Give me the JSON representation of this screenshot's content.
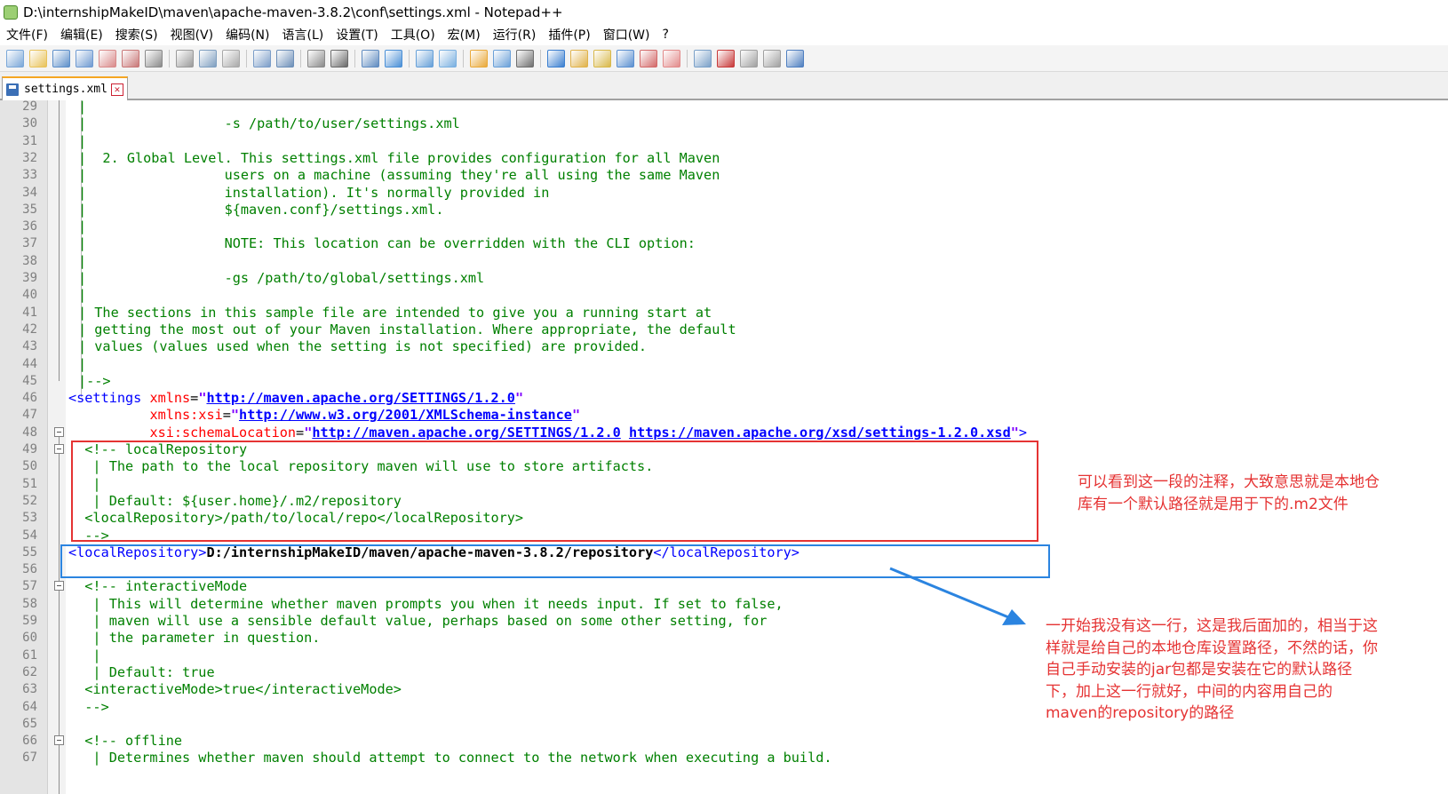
{
  "window": {
    "title": "D:\\internshipMakeID\\maven\\apache-maven-3.8.2\\conf\\settings.xml - Notepad++"
  },
  "menu": [
    "文件(F)",
    "编辑(E)",
    "搜索(S)",
    "视图(V)",
    "编码(N)",
    "语言(L)",
    "设置(T)",
    "工具(O)",
    "宏(M)",
    "运行(R)",
    "插件(P)",
    "窗口(W)",
    "?"
  ],
  "toolbar_icons": [
    "new-file-icon",
    "open-file-icon",
    "save-icon",
    "save-all-icon",
    "close-icon",
    "close-all-icon",
    "print-icon",
    "|",
    "cut-icon",
    "copy-icon",
    "paste-icon",
    "|",
    "undo-icon",
    "redo-icon",
    "|",
    "find-icon",
    "replace-icon",
    "|",
    "zoom-in-icon",
    "zoom-out-icon",
    "|",
    "sync-vertical-icon",
    "sync-horizontal-icon",
    "|",
    "word-wrap-icon",
    "show-all-chars-icon",
    "indent-guide-icon",
    "|",
    "user-lang-icon",
    "doc-map-icon",
    "function-list-icon",
    "folder-workspace-icon",
    "doc-list-icon",
    "monitoring-icon",
    "|",
    "record-macro-icon",
    "stop-macro-icon",
    "play-macro-icon",
    "run-macro-multiple-icon",
    "save-macro-icon"
  ],
  "tab": {
    "label": "settings.xml"
  },
  "lines": [
    {
      "n": "29",
      "segs": [
        [
          "c-com",
          "|"
        ]
      ]
    },
    {
      "n": "30",
      "segs": [
        [
          "c-com",
          "|                 -s /path/to/user/settings.xml"
        ]
      ]
    },
    {
      "n": "31",
      "segs": [
        [
          "c-com",
          "|"
        ]
      ]
    },
    {
      "n": "32",
      "segs": [
        [
          "c-com",
          "|  2. Global Level. This settings.xml file provides configuration for all Maven"
        ]
      ]
    },
    {
      "n": "33",
      "segs": [
        [
          "c-com",
          "|                 users on a machine (assuming they're all using the same Maven"
        ]
      ]
    },
    {
      "n": "34",
      "segs": [
        [
          "c-com",
          "|                 installation). It's normally provided in"
        ]
      ]
    },
    {
      "n": "35",
      "segs": [
        [
          "c-com",
          "|                 ${maven.conf}/settings.xml."
        ]
      ]
    },
    {
      "n": "36",
      "segs": [
        [
          "c-com",
          "|"
        ]
      ]
    },
    {
      "n": "37",
      "segs": [
        [
          "c-com",
          "|                 NOTE: This location can be overridden with the CLI option:"
        ]
      ]
    },
    {
      "n": "38",
      "segs": [
        [
          "c-com",
          "|"
        ]
      ]
    },
    {
      "n": "39",
      "segs": [
        [
          "c-com",
          "|                 -gs /path/to/global/settings.xml"
        ]
      ]
    },
    {
      "n": "40",
      "segs": [
        [
          "c-com",
          "|"
        ]
      ]
    },
    {
      "n": "41",
      "segs": [
        [
          "c-com",
          "| The sections in this sample file are intended to give you a running start at"
        ]
      ]
    },
    {
      "n": "42",
      "segs": [
        [
          "c-com",
          "| getting the most out of your Maven installation. Where appropriate, the default"
        ]
      ]
    },
    {
      "n": "43",
      "segs": [
        [
          "c-com",
          "| values (values used when the setting is not specified) are provided."
        ]
      ]
    },
    {
      "n": "44",
      "segs": [
        [
          "c-com",
          "|"
        ]
      ]
    },
    {
      "n": "45",
      "segs": [
        [
          "c-com",
          "|-->"
        ]
      ]
    },
    {
      "n": "46",
      "segs": [
        [
          "c-tag",
          "<settings "
        ],
        [
          "c-attr",
          "xmlns"
        ],
        [
          "c-plain",
          "="
        ],
        [
          "c-str",
          "\""
        ],
        [
          "c-url",
          "http://maven.apache.org/SETTINGS/1.2.0"
        ],
        [
          "c-str",
          "\""
        ]
      ]
    },
    {
      "n": "47",
      "segs": [
        [
          "c-plain",
          "          "
        ],
        [
          "c-attr",
          "xmlns:xsi"
        ],
        [
          "c-plain",
          "="
        ],
        [
          "c-str",
          "\""
        ],
        [
          "c-url",
          "http://www.w3.org/2001/XMLSchema-instance"
        ],
        [
          "c-str",
          "\""
        ]
      ]
    },
    {
      "n": "48",
      "segs": [
        [
          "c-plain",
          "          "
        ],
        [
          "c-attr",
          "xsi:schemaLocation"
        ],
        [
          "c-plain",
          "="
        ],
        [
          "c-str",
          "\""
        ],
        [
          "c-url",
          "http://maven.apache.org/SETTINGS/1.2.0"
        ],
        [
          "c-plain",
          " "
        ],
        [
          "c-url",
          "https://maven.apache.org/xsd/settings-1.2.0.xsd"
        ],
        [
          "c-str",
          "\""
        ],
        [
          "c-tag",
          ">"
        ]
      ]
    },
    {
      "n": "49",
      "segs": [
        [
          "c-com",
          "  <!-- localRepository"
        ]
      ]
    },
    {
      "n": "50",
      "segs": [
        [
          "c-com",
          "   | The path to the local repository maven will use to store artifacts."
        ]
      ]
    },
    {
      "n": "51",
      "segs": [
        [
          "c-com",
          "   |"
        ]
      ]
    },
    {
      "n": "52",
      "segs": [
        [
          "c-com",
          "   | Default: ${user.home}/.m2/repository"
        ]
      ]
    },
    {
      "n": "53",
      "segs": [
        [
          "c-com",
          "  <localRepository>/path/to/local/repo</localRepository>"
        ]
      ]
    },
    {
      "n": "54",
      "segs": [
        [
          "c-com",
          "  -->"
        ]
      ]
    },
    {
      "n": "55",
      "segs": [
        [
          "c-tag",
          "<localRepository>"
        ],
        [
          "c-txt",
          "D:/internshipMakeID/maven/apache-maven-3.8.2/repository"
        ],
        [
          "c-tag",
          "</localRepository>"
        ]
      ]
    },
    {
      "n": "56",
      "segs": []
    },
    {
      "n": "57",
      "segs": [
        [
          "c-com",
          "  <!-- interactiveMode"
        ]
      ]
    },
    {
      "n": "58",
      "segs": [
        [
          "c-com",
          "   | This will determine whether maven prompts you when it needs input. If set to false,"
        ]
      ]
    },
    {
      "n": "59",
      "segs": [
        [
          "c-com",
          "   | maven will use a sensible default value, perhaps based on some other setting, for"
        ]
      ]
    },
    {
      "n": "60",
      "segs": [
        [
          "c-com",
          "   | the parameter in question."
        ]
      ]
    },
    {
      "n": "61",
      "segs": [
        [
          "c-com",
          "   |"
        ]
      ]
    },
    {
      "n": "62",
      "segs": [
        [
          "c-com",
          "   | Default: true"
        ]
      ]
    },
    {
      "n": "63",
      "segs": [
        [
          "c-com",
          "  <interactiveMode>true</interactiveMode>"
        ]
      ]
    },
    {
      "n": "64",
      "segs": [
        [
          "c-com",
          "  -->"
        ]
      ]
    },
    {
      "n": "65",
      "segs": []
    },
    {
      "n": "66",
      "segs": [
        [
          "c-com",
          "  <!-- offline"
        ]
      ]
    },
    {
      "n": "67",
      "segs": [
        [
          "c-com",
          "   | Determines whether maven should attempt to connect to the network when executing a build."
        ]
      ]
    }
  ],
  "annotations": {
    "note1": [
      "可以看到这一段的注释，大致意思就是本地仓",
      "库有一个默认路径就是用于下的.m2文件"
    ],
    "note2": [
      "一开始我没有这一行，这是我后面加的，相当于这",
      "样就是给自己的本地仓库设置路径，不然的话，你",
      "自己手动安装的jar包都是安装在它的默认路径",
      "下，加上这一行就好，中间的内容用自己的",
      "maven的repository的路径"
    ]
  }
}
